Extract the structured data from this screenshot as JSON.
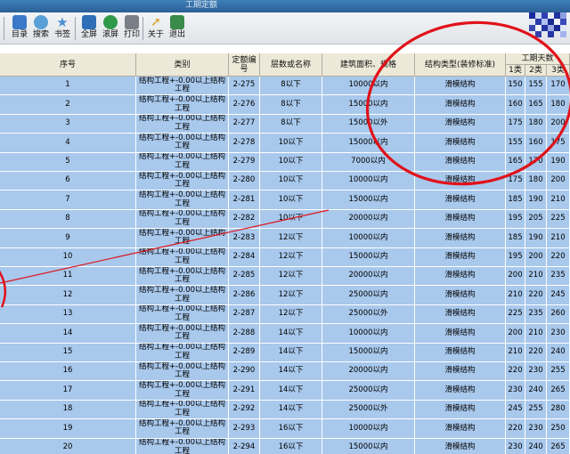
{
  "window": {
    "title": "工期定额"
  },
  "toolbar": {
    "buttons": [
      {
        "label": "目录",
        "icon": "book-icon",
        "color": "#3a78c8"
      },
      {
        "label": "搜索",
        "icon": "search-icon",
        "color": "#5aa0d8"
      },
      {
        "label": "书签",
        "icon": "star-icon",
        "color": "#7fb4e0"
      },
      {
        "label": "全屏",
        "icon": "fullscreen-icon",
        "color": "#2f6fb8"
      },
      {
        "label": "滚屏",
        "icon": "refresh-icon",
        "color": "#2e9a4a"
      },
      {
        "label": "打印",
        "icon": "printer-icon",
        "color": "#7a7f86"
      },
      {
        "label": "关于",
        "icon": "cursor-icon",
        "color": "#d8a020"
      },
      {
        "label": "退出",
        "icon": "exit-icon",
        "color": "#3a8a4a"
      }
    ]
  },
  "colors": {
    "row_bg": "#a8c8ec",
    "header_bg": "#ece9d8",
    "annotation": "#e0121a"
  },
  "table": {
    "headers": {
      "seq": "序号",
      "category": "类别",
      "code": "定额编号",
      "floors": "层数或名称",
      "area": "建筑面积、规格",
      "structure": "结构类型(装修标准)",
      "days": "工期天数",
      "class1": "1类",
      "class2": "2类",
      "class3": "3类"
    },
    "rows": [
      {
        "seq": "1",
        "category": "结构工程+-0.00以上结构工程",
        "code": "2-275",
        "floors": "8以下",
        "area": "10000以内",
        "structure": "滑模结构",
        "d1": "150",
        "d2": "155",
        "d3": "170"
      },
      {
        "seq": "2",
        "category": "结构工程+-0.00以上结构工程",
        "code": "2-276",
        "floors": "8以下",
        "area": "15000以内",
        "structure": "滑模结构",
        "d1": "160",
        "d2": "165",
        "d3": "180"
      },
      {
        "seq": "3",
        "category": "结构工程+-0.00以上结构工程",
        "code": "2-277",
        "floors": "8以下",
        "area": "15000以外",
        "structure": "滑模结构",
        "d1": "175",
        "d2": "180",
        "d3": "200"
      },
      {
        "seq": "4",
        "category": "结构工程+-0.00以上结构工程",
        "code": "2-278",
        "floors": "10以下",
        "area": "15000以内",
        "structure": "滑模结构",
        "d1": "155",
        "d2": "160",
        "d3": "175"
      },
      {
        "seq": "5",
        "category": "结构工程+-0.00以上结构工程",
        "code": "2-279",
        "floors": "10以下",
        "area": "7000以内",
        "structure": "滑模结构",
        "d1": "165",
        "d2": "170",
        "d3": "190"
      },
      {
        "seq": "6",
        "category": "结构工程+-0.00以上结构工程",
        "code": "2-280",
        "floors": "10以下",
        "area": "10000以内",
        "structure": "滑模结构",
        "d1": "175",
        "d2": "180",
        "d3": "200"
      },
      {
        "seq": "7",
        "category": "结构工程+-0.00以上结构工程",
        "code": "2-281",
        "floors": "10以下",
        "area": "15000以内",
        "structure": "滑模结构",
        "d1": "185",
        "d2": "190",
        "d3": "210"
      },
      {
        "seq": "8",
        "category": "结构工程+-0.00以上结构工程",
        "code": "2-282",
        "floors": "10以下",
        "area": "20000以内",
        "structure": "滑模结构",
        "d1": "195",
        "d2": "205",
        "d3": "225"
      },
      {
        "seq": "9",
        "category": "结构工程+-0.00以上结构工程",
        "code": "2-283",
        "floors": "12以下",
        "area": "10000以内",
        "structure": "滑模结构",
        "d1": "185",
        "d2": "190",
        "d3": "210"
      },
      {
        "seq": "10",
        "category": "结构工程+-0.00以上结构工程",
        "code": "2-284",
        "floors": "12以下",
        "area": "15000以内",
        "structure": "滑模结构",
        "d1": "195",
        "d2": "200",
        "d3": "220"
      },
      {
        "seq": "11",
        "category": "结构工程+-0.00以上结构工程",
        "code": "2-285",
        "floors": "12以下",
        "area": "20000以内",
        "structure": "滑模结构",
        "d1": "200",
        "d2": "210",
        "d3": "235"
      },
      {
        "seq": "12",
        "category": "结构工程+-0.00以上结构工程",
        "code": "2-286",
        "floors": "12以下",
        "area": "25000以内",
        "structure": "滑模结构",
        "d1": "210",
        "d2": "220",
        "d3": "245"
      },
      {
        "seq": "13",
        "category": "结构工程+-0.00以上结构工程",
        "code": "2-287",
        "floors": "12以下",
        "area": "25000以外",
        "structure": "滑模结构",
        "d1": "225",
        "d2": "235",
        "d3": "260"
      },
      {
        "seq": "14",
        "category": "结构工程+-0.00以上结构工程",
        "code": "2-288",
        "floors": "14以下",
        "area": "10000以内",
        "structure": "滑模结构",
        "d1": "200",
        "d2": "210",
        "d3": "230"
      },
      {
        "seq": "15",
        "category": "结构工程+-0.00以上结构工程",
        "code": "2-289",
        "floors": "14以下",
        "area": "15000以内",
        "structure": "滑模结构",
        "d1": "210",
        "d2": "220",
        "d3": "240"
      },
      {
        "seq": "16",
        "category": "结构工程+-0.00以上结构工程",
        "code": "2-290",
        "floors": "14以下",
        "area": "20000以内",
        "structure": "滑模结构",
        "d1": "220",
        "d2": "230",
        "d3": "255"
      },
      {
        "seq": "17",
        "category": "结构工程+-0.00以上结构工程",
        "code": "2-291",
        "floors": "14以下",
        "area": "25000以内",
        "structure": "滑模结构",
        "d1": "230",
        "d2": "240",
        "d3": "265"
      },
      {
        "seq": "18",
        "category": "结构工程+-0.00以上结构工程",
        "code": "2-292",
        "floors": "14以下",
        "area": "25000以外",
        "structure": "滑模结构",
        "d1": "245",
        "d2": "255",
        "d3": "280"
      },
      {
        "seq": "19",
        "category": "结构工程+-0.00以上结构工程",
        "code": "2-293",
        "floors": "16以下",
        "area": "10000以内",
        "structure": "滑模结构",
        "d1": "220",
        "d2": "230",
        "d3": "250"
      },
      {
        "seq": "20",
        "category": "结构工程+-0.00以上结构工程",
        "code": "2-294",
        "floors": "16以下",
        "area": "15000以内",
        "structure": "滑模结构",
        "d1": "230",
        "d2": "240",
        "d3": "265"
      }
    ]
  }
}
